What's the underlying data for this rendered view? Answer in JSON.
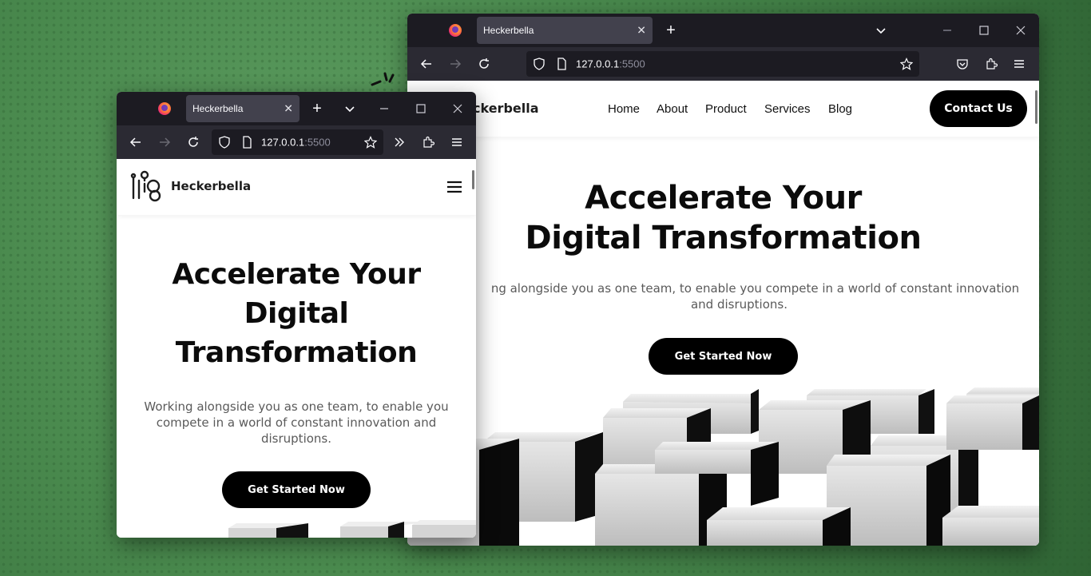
{
  "browser_large": {
    "tab_title": "Heckerbella",
    "url_host": "127.0.0.1",
    "url_port": ":5500"
  },
  "browser_small": {
    "tab_title": "Heckerbella",
    "url_host": "127.0.0.1",
    "url_port": ":5500"
  },
  "site": {
    "brand": "Heckerbella",
    "brand_partial": "ckerbella",
    "nav": [
      "Home",
      "About",
      "Product",
      "Services",
      "Blog"
    ],
    "cta": "Contact Us",
    "hero_title_line1": "Accelerate Your",
    "hero_title_line2": "Digital Transformation",
    "hero_title_small_1": "Accelerate Your",
    "hero_title_small_2": "Digital",
    "hero_title_small_3": "Transformation",
    "subtitle_large_1": "ng alongside you as one team, to enable you compete in a world of constant innovation",
    "subtitle_large_2": "and disruptions.",
    "subtitle_small": "Working alongside you as one team, to enable you compete in a world of constant innovation and disruptions.",
    "button": "Get Started Now"
  },
  "colors": {
    "accent": "#000000",
    "browser_chrome": "#1c1b22",
    "toolbar": "#2b2a33",
    "background_green": "#4a8a4e"
  }
}
